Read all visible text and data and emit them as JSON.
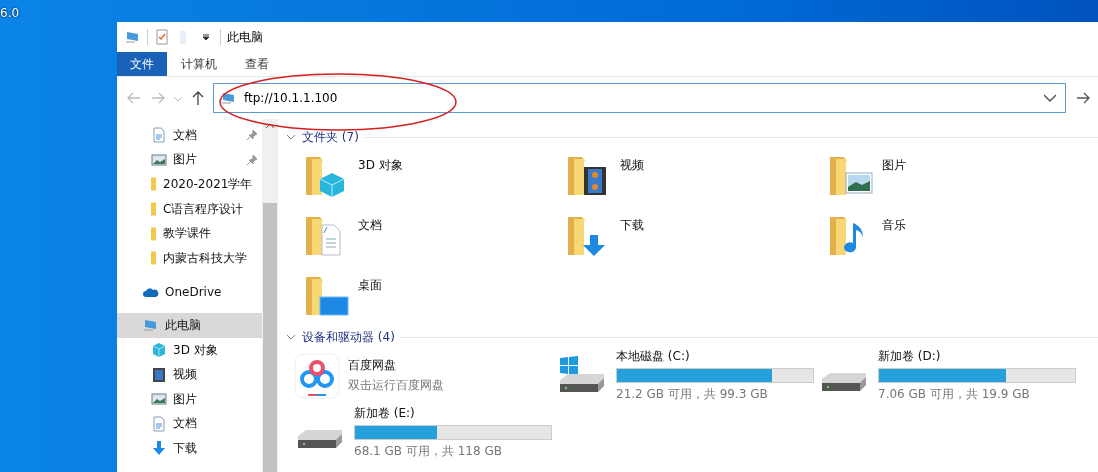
{
  "desktop": {
    "text": "6.0"
  },
  "window": {
    "title": "此电脑"
  },
  "ribbon_tabs": [
    {
      "label": "文件",
      "selected": true
    },
    {
      "label": "计算机",
      "selected": false
    },
    {
      "label": "查看",
      "selected": false
    }
  ],
  "address_bar": {
    "value": "ftp://10.1.1.100"
  },
  "sidebar": {
    "items": [
      {
        "label": "文档",
        "kind": "document",
        "pinned": true,
        "selected": false
      },
      {
        "label": "图片",
        "kind": "picture",
        "pinned": true,
        "selected": false
      },
      {
        "label": "2020-2021学年",
        "kind": "folder",
        "pinned": false,
        "selected": false
      },
      {
        "label": "C语言程序设计",
        "kind": "folder",
        "pinned": false,
        "selected": false
      },
      {
        "label": "教学课件",
        "kind": "folder",
        "pinned": false,
        "selected": false
      },
      {
        "label": "内蒙古科技大学",
        "kind": "folder",
        "pinned": false,
        "selected": false
      },
      {
        "label": "OneDrive",
        "kind": "cloud",
        "pinned": false,
        "selected": false
      },
      {
        "label": "此电脑",
        "kind": "computer",
        "pinned": false,
        "selected": true
      },
      {
        "label": "3D 对象",
        "kind": "cube",
        "pinned": false,
        "selected": false
      },
      {
        "label": "视频",
        "kind": "video",
        "pinned": false,
        "selected": false
      },
      {
        "label": "图片",
        "kind": "picture",
        "pinned": false,
        "selected": false
      },
      {
        "label": "文档",
        "kind": "document",
        "pinned": false,
        "selected": false
      },
      {
        "label": "下载",
        "kind": "download",
        "pinned": false,
        "selected": false
      }
    ]
  },
  "folders": {
    "title": "文件夹 (7)",
    "items": [
      {
        "label": "3D 对象",
        "kind": "cube"
      },
      {
        "label": "视频",
        "kind": "video"
      },
      {
        "label": "图片",
        "kind": "picture"
      },
      {
        "label": "文档",
        "kind": "document"
      },
      {
        "label": "下载",
        "kind": "download"
      },
      {
        "label": "音乐",
        "kind": "music"
      },
      {
        "label": "桌面",
        "kind": "desktop"
      }
    ]
  },
  "devices": {
    "title": "设备和驱动器 (4)",
    "items": [
      {
        "kind": "app",
        "name": "百度网盘",
        "subtitle": "双击运行百度网盘"
      },
      {
        "kind": "system_drive",
        "name": "本地磁盘 (C:)",
        "level": 0.79,
        "reading": "21.2 GB 可用，共 99.3 GB"
      },
      {
        "kind": "drive",
        "name": "新加卷 (D:)",
        "level": 0.65,
        "reading": "7.06 GB 可用，共 19.9 GB"
      },
      {
        "kind": "drive",
        "name": "新加卷 (E:)",
        "level": 0.42,
        "reading": "68.1 GB 可用，共 118 GB"
      }
    ]
  }
}
